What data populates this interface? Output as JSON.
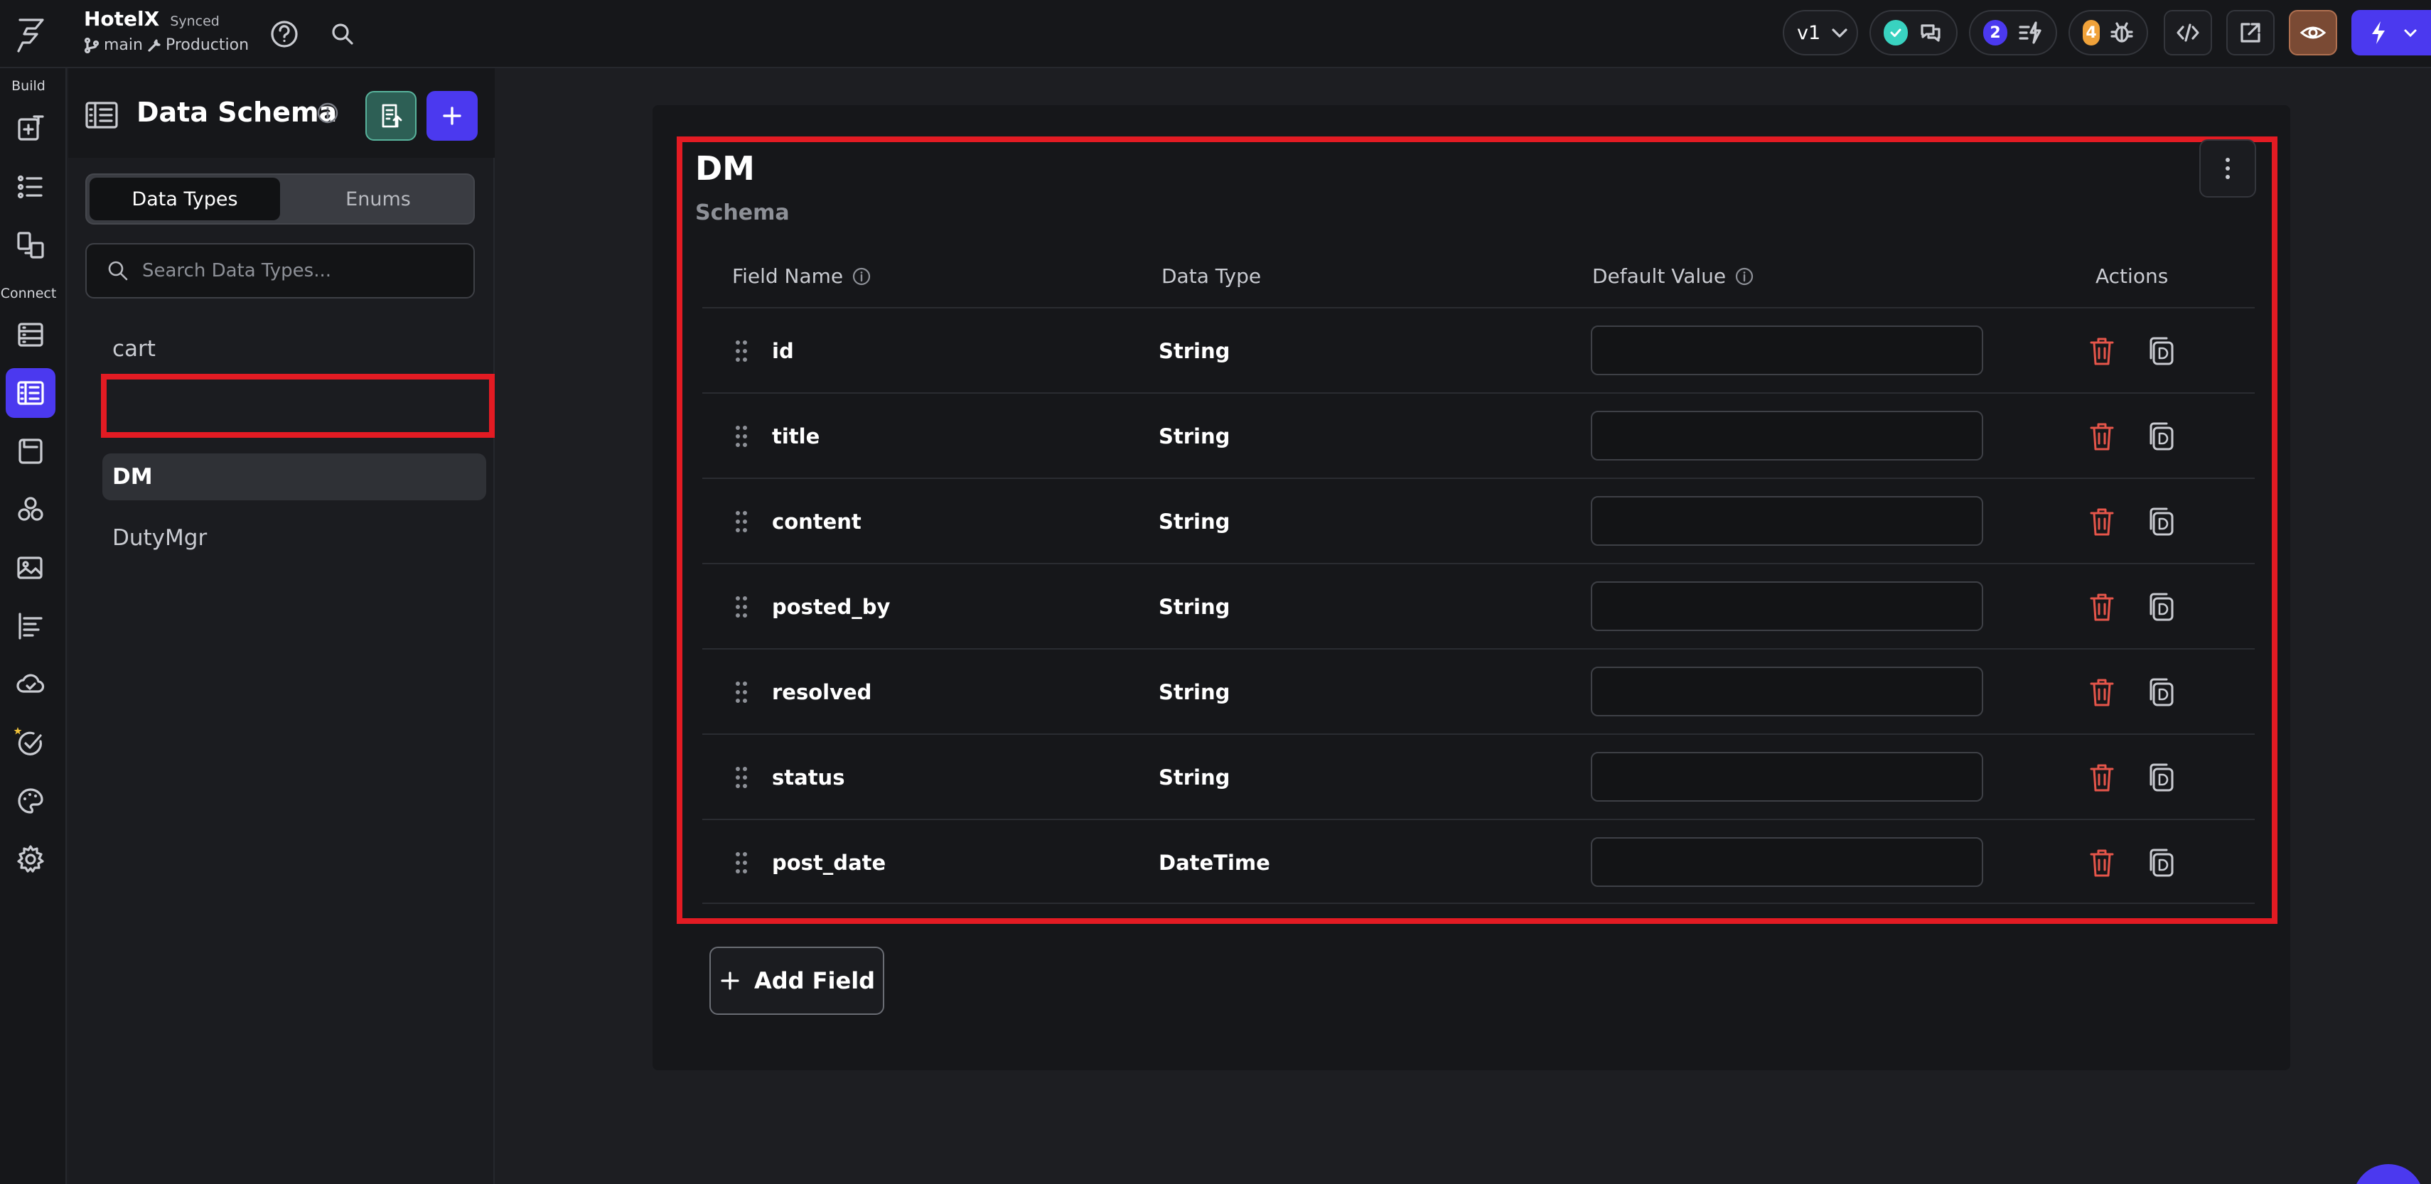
{
  "app": {
    "project_name": "HotelX",
    "sync_status": "Synced",
    "branch": "main",
    "environment": "Production",
    "version": "v1",
    "notifications_count": "2",
    "issues_count": "4",
    "accent_color": "#4b39ef",
    "success_color": "#39d2c0",
    "warning_color": "#f0a23a",
    "danger_color": "#e5554a"
  },
  "rail": {
    "build_label": "Build",
    "connect_label": "Connect"
  },
  "schema_panel": {
    "title": "Data Schema",
    "tabs": [
      {
        "label": "Data Types",
        "active": true
      },
      {
        "label": "Enums",
        "active": false
      }
    ],
    "search": {
      "placeholder": "Search Data Types...",
      "value": ""
    },
    "types": [
      {
        "name": "cart",
        "selected": false
      },
      {
        "name": "DM",
        "selected": true
      },
      {
        "name": "DutyMgr",
        "selected": false
      }
    ]
  },
  "schema": {
    "name": "DM",
    "subtitle": "Schema",
    "columns": {
      "field_name": "Field Name",
      "data_type": "Data Type",
      "default_value": "Default Value",
      "actions": "Actions"
    },
    "fields": [
      {
        "name": "id",
        "type": "String",
        "default": ""
      },
      {
        "name": "title",
        "type": "String",
        "default": ""
      },
      {
        "name": "content",
        "type": "String",
        "default": ""
      },
      {
        "name": "posted_by",
        "type": "String",
        "default": ""
      },
      {
        "name": "resolved",
        "type": "String",
        "default": ""
      },
      {
        "name": "status",
        "type": "String",
        "default": ""
      },
      {
        "name": "post_date",
        "type": "DateTime",
        "default": ""
      }
    ],
    "add_field_label": "Add Field"
  }
}
